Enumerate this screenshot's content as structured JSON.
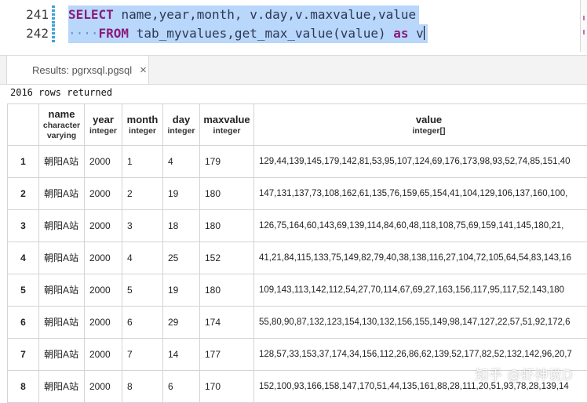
{
  "editor": {
    "lines": [
      {
        "number": "241"
      },
      {
        "number": "242"
      }
    ],
    "line1": {
      "select_kw": "SELECT",
      "columns": "name,year,month, v.day,v.maxvalue,value"
    },
    "line2": {
      "from_kw": "FROM",
      "sources": "tab_myvalues,get_max_value(value)",
      "as_kw": "as",
      "alias": "v"
    }
  },
  "results_tab": {
    "label": "Results: pgrxsql.pgsql",
    "close_glyph": "×"
  },
  "status_text": "2016 rows returned",
  "columns": [
    {
      "title": "",
      "type": ""
    },
    {
      "title": "name",
      "type": "character varying"
    },
    {
      "title": "year",
      "type": "integer"
    },
    {
      "title": "month",
      "type": "integer"
    },
    {
      "title": "day",
      "type": "integer"
    },
    {
      "title": "maxvalue",
      "type": "integer"
    },
    {
      "title": "value",
      "type": "integer[]"
    }
  ],
  "rows": [
    {
      "n": "1",
      "name": "朝阳A站",
      "year": "2000",
      "month": "1",
      "day": "4",
      "maxvalue": "179",
      "value": "129,44,139,145,179,142,81,53,95,107,124,69,176,173,98,93,52,74,85,151,40"
    },
    {
      "n": "2",
      "name": "朝阳A站",
      "year": "2000",
      "month": "2",
      "day": "19",
      "maxvalue": "180",
      "value": "147,131,137,73,108,162,61,135,76,159,65,154,41,104,129,106,137,160,100,"
    },
    {
      "n": "3",
      "name": "朝阳A站",
      "year": "2000",
      "month": "3",
      "day": "18",
      "maxvalue": "180",
      "value": "126,75,164,60,143,69,139,114,84,60,48,118,108,75,69,159,141,145,180,21,"
    },
    {
      "n": "4",
      "name": "朝阳A站",
      "year": "2000",
      "month": "4",
      "day": "25",
      "maxvalue": "152",
      "value": "41,21,84,115,133,75,149,82,79,40,38,138,116,27,104,72,105,64,54,83,143,16"
    },
    {
      "n": "5",
      "name": "朝阳A站",
      "year": "2000",
      "month": "5",
      "day": "19",
      "maxvalue": "180",
      "value": "109,143,113,142,112,54,27,70,114,67,69,27,163,156,117,95,117,52,143,180"
    },
    {
      "n": "6",
      "name": "朝阳A站",
      "year": "2000",
      "month": "6",
      "day": "29",
      "maxvalue": "174",
      "value": "55,80,90,87,132,123,154,130,132,156,155,149,98,147,127,22,57,51,92,172,6"
    },
    {
      "n": "7",
      "name": "朝阳A站",
      "year": "2000",
      "month": "7",
      "day": "14",
      "maxvalue": "177",
      "value": "128,57,33,153,37,174,34,156,112,26,86,62,139,52,177,82,52,132,142,96,20,7"
    },
    {
      "n": "8",
      "name": "朝阳A站",
      "year": "2000",
      "month": "8",
      "day": "6",
      "maxvalue": "170",
      "value": "152,100,93,166,158,147,170,51,44,135,161,88,28,111,20,51,93,78,28,139,14"
    }
  ],
  "watermark": "知乎 @虾神说D",
  "colors": {
    "keyword": "#8a1d7b",
    "selection": "#b9d6fb",
    "gutter_marker": "#3aa3d8",
    "grid_border": "#d4d4d4"
  }
}
